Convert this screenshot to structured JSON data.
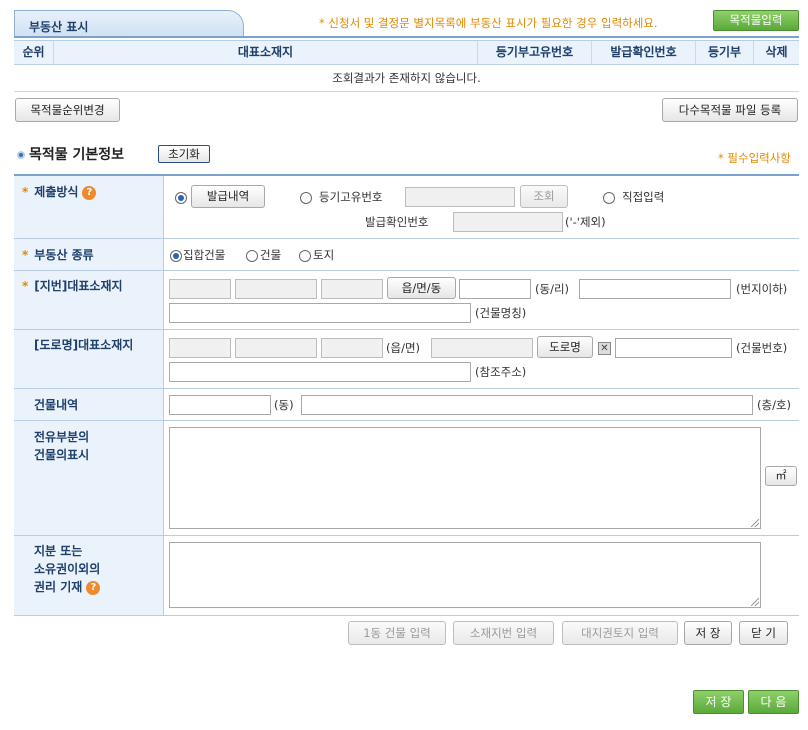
{
  "tab": {
    "label": "부동산 표시"
  },
  "notice": "* 신청서 및 결정문 별지목록에 부동산 표시가 필요한 경우 입력하세요.",
  "top_button": "목적물입력",
  "table": {
    "columns": [
      "순위",
      "대표소재지",
      "등기부고유번호",
      "발급확인번호",
      "등기부",
      "삭제"
    ],
    "empty_message": "조회결과가 존재하지 않습니다."
  },
  "buttons": {
    "order_change": "목적물순위변경",
    "multi_upload": "다수목적물 파일 등록",
    "reset": "초기화",
    "lookup": "조회",
    "issue_history": "발급내역",
    "eup_myeon_dong": "읍/면/동",
    "road_name": "도로명",
    "area_unit": "㎡",
    "one_building": "1동 건물 입력",
    "lot_input": "소재지번 입력",
    "land_right": "대지권토지 입력",
    "save_small": "저 장",
    "close": "닫 기",
    "save": "저 장",
    "next": "다 음"
  },
  "section": {
    "title": "목적물 기본정보",
    "required_note": "* 필수입력사항"
  },
  "form": {
    "submit_method": {
      "label": "제출방식",
      "option_registry_no": "등기고유번호",
      "option_direct": "직접입력",
      "issue_confirm_label": "발급확인번호",
      "issue_confirm_hint": "('-'제외)"
    },
    "property_type": {
      "label": "부동산 종류",
      "options": [
        "집합건물",
        "건물",
        "토지"
      ]
    },
    "lot_address": {
      "label": "[지번]대표소재지",
      "dong_ri": "(동/리)",
      "lot_below": "(번지이하)",
      "building_name": "(건물명칭)"
    },
    "road_address": {
      "label": "[도로명]대표소재지",
      "eup_myeon": "(읍/면)",
      "building_no": "(건물번호)",
      "reference": "(참조주소)"
    },
    "building_detail": {
      "label": "건물내역",
      "dong": "(동)",
      "floor_ho": "(층/호)"
    },
    "exclusive_part": {
      "label_line1": "전유부분의",
      "label_line2": "건물의표시"
    },
    "share_rights": {
      "label_line1": "지분 또는",
      "label_line2": "소유권이외의",
      "label_line3": "권리 기재"
    }
  },
  "colors": {
    "accent_blue": "#20406c",
    "required_orange": "#e08a00",
    "button_green": "#5aa93a"
  }
}
